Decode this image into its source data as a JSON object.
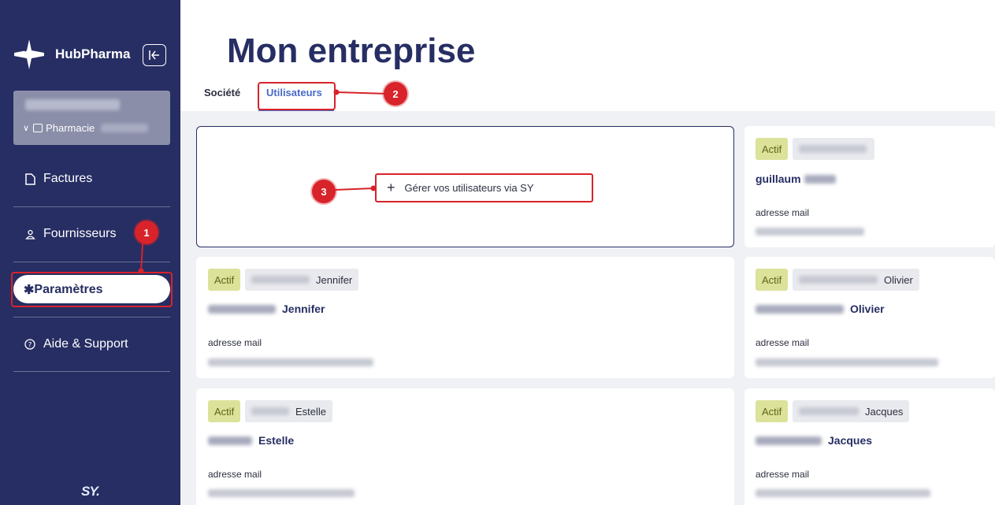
{
  "app": {
    "brand": "HubPharma",
    "footer_logo": "SY."
  },
  "account": {
    "pharmacy_label": "Pharmacie"
  },
  "nav": [
    {
      "label": "Factures",
      "icon": "document-icon"
    },
    {
      "label": "Fournisseurs",
      "icon": "user-icon"
    },
    {
      "label": "Paramètres",
      "icon": "gear-icon"
    },
    {
      "label": "Aide & Support",
      "icon": "help-icon"
    }
  ],
  "page": {
    "title": "Mon entreprise"
  },
  "tabs": [
    {
      "label": "Société"
    },
    {
      "label": "Utilisateurs"
    }
  ],
  "manage": {
    "label": "Gérer vos utilisateurs via SY"
  },
  "callouts": [
    "1",
    "2",
    "3"
  ],
  "users": [
    {
      "status": "Actif",
      "pill_first": "",
      "first": "guillaum",
      "mail_label": "adresse mail"
    },
    {
      "status": "Actif",
      "pill_first": "Jennifer",
      "first": "Jennifer",
      "mail_label": "adresse mail"
    },
    {
      "status": "Actif",
      "pill_first": "Olivier",
      "first": "Olivier",
      "mail_label": "adresse mail"
    },
    {
      "status": "Actif",
      "pill_first": "Estelle",
      "first": "Estelle",
      "mail_label": "adresse mail"
    },
    {
      "status": "Actif",
      "pill_first": "Jacques",
      "first": "Jacques",
      "mail_label": "adresse mail"
    }
  ],
  "colors": {
    "sidebar": "#262e63",
    "accent": "#4a69c6",
    "highlight": "#d8232a",
    "active_badge": "#dde29a"
  }
}
